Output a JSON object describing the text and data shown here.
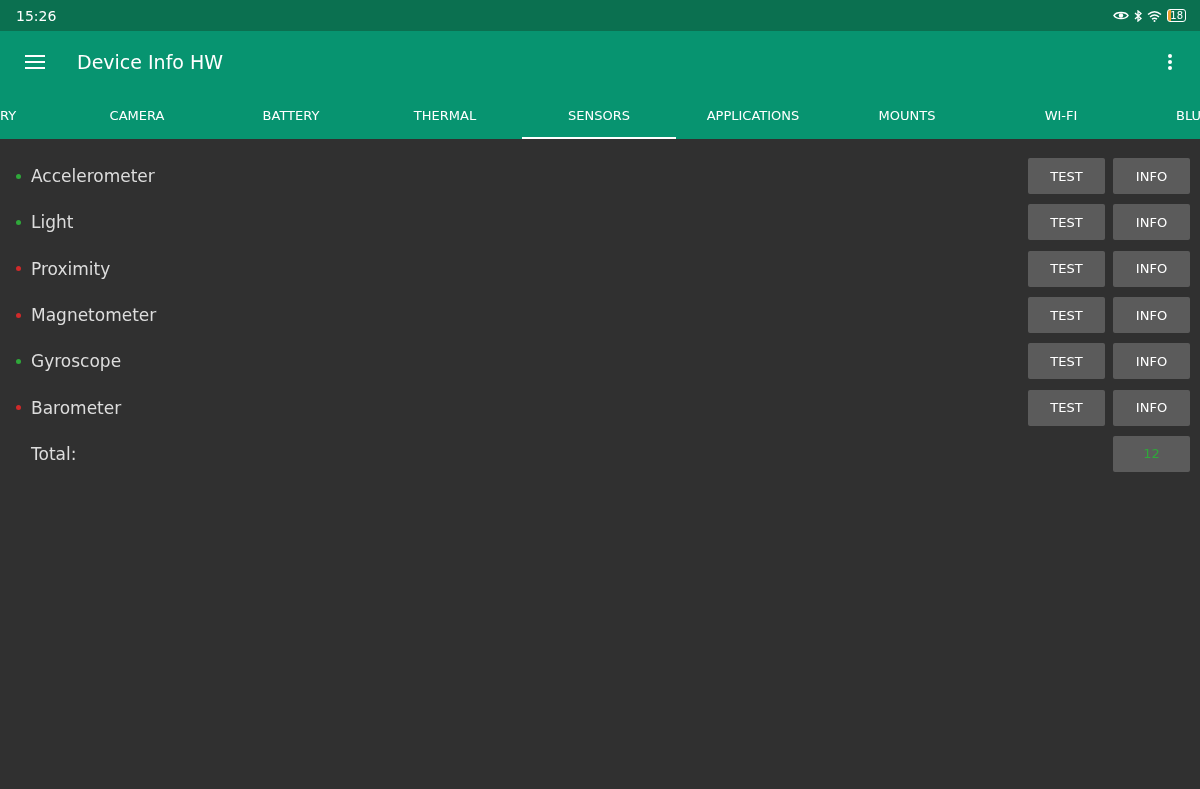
{
  "status_bar": {
    "time": "15:26",
    "battery": "18"
  },
  "app_bar": {
    "title": "Device Info HW"
  },
  "tabs": [
    {
      "label": "RY",
      "selected": false
    },
    {
      "label": "CAMERA",
      "selected": false
    },
    {
      "label": "BATTERY",
      "selected": false
    },
    {
      "label": "THERMAL",
      "selected": false
    },
    {
      "label": "SENSORS",
      "selected": true
    },
    {
      "label": "APPLICATIONS",
      "selected": false
    },
    {
      "label": "MOUNTS",
      "selected": false
    },
    {
      "label": "WI-FI",
      "selected": false
    },
    {
      "label": "BLU",
      "selected": false
    }
  ],
  "sensors": [
    {
      "name": "Accelerometer",
      "color": "#2fa83a",
      "buttons": [
        "TEST",
        "INFO"
      ]
    },
    {
      "name": "Light",
      "color": "#2fa83a",
      "buttons": [
        "TEST",
        "INFO"
      ]
    },
    {
      "name": "Proximity",
      "color": "#d02a2a",
      "buttons": [
        "TEST",
        "INFO"
      ]
    },
    {
      "name": "Magnetometer",
      "color": "#d02a2a",
      "buttons": [
        "TEST",
        "INFO"
      ]
    },
    {
      "name": "Gyroscope",
      "color": "#2fa83a",
      "buttons": [
        "TEST",
        "INFO"
      ]
    },
    {
      "name": "Barometer",
      "color": "#d02a2a",
      "buttons": [
        "TEST",
        "INFO"
      ]
    }
  ],
  "total": {
    "label": "Total:",
    "value": "12"
  }
}
